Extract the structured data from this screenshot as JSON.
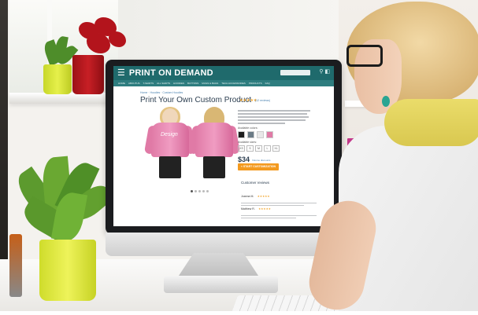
{
  "photo": {
    "subject": "woman-at-desktop-computer"
  },
  "screen": {
    "brand": "PRINT ON DEMAND",
    "menu_icon": "hamburger-icon",
    "nav_items": [
      "HOME",
      "ABOUTUS",
      "T-SHIRTS",
      "ALL SHIRTS",
      "HOODIES",
      "BUTTONS",
      "MUGS & BAGS",
      "TECH ACCESSORIES",
      "PRODUCTS",
      "FAQ"
    ],
    "breadcrumb": "Home · Hoodies · Custom Hoodies",
    "product_title": "Print Your Own Custom Product",
    "rating_stars": "★★★★★",
    "reviews_link": "(12 reviews)",
    "print_mark": "Design",
    "available_colors_label": "Available colors:",
    "colors": [
      "#1e1e1e",
      "#6b7b86",
      "#e8e8e8",
      "#e07aa6"
    ],
    "available_sizes_label": "Available sizes:",
    "sizes": [
      "XS",
      "S",
      "M",
      "L",
      "XL"
    ],
    "price": "$34",
    "price_note": "Volume discounts",
    "cta_label": "» START CUSTOMIZATION",
    "customer_reviews_label": "Customer reviews",
    "reviews": [
      {
        "name": "Joanna M.",
        "stars": "★★★★★"
      },
      {
        "name": "Matthew R.",
        "stars": "★★★★★"
      }
    ]
  }
}
